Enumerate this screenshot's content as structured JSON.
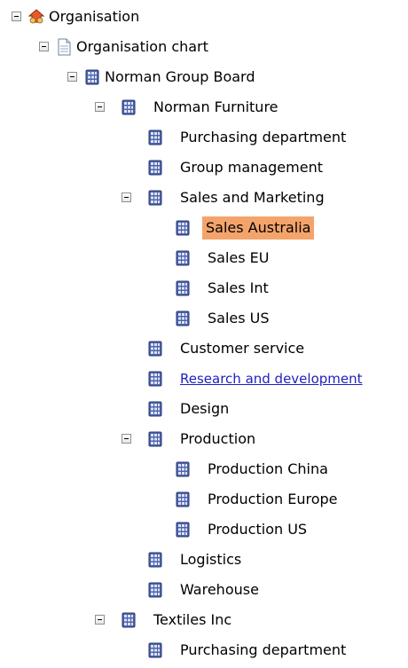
{
  "colors": {
    "selected_bg": "#f4a46a",
    "link": "#1f1fbf",
    "toggle_border": "#8e8f8f"
  },
  "tree": {
    "nodes": [
      {
        "label": "Organisation",
        "icon": "organisation-icon",
        "expanded": true
      },
      {
        "label": "Organisation chart",
        "icon": "document-icon",
        "expanded": true
      },
      {
        "label": "Norman Group Board",
        "icon": "building-icon",
        "expanded": true
      },
      {
        "label": "Norman Furniture",
        "icon": "building-icon",
        "expanded": true
      },
      {
        "label": "Purchasing department",
        "icon": "building-icon"
      },
      {
        "label": "Group management",
        "icon": "building-icon"
      },
      {
        "label": "Sales and Marketing",
        "icon": "building-icon",
        "expanded": true
      },
      {
        "label": "Sales Australia",
        "icon": "building-icon",
        "selected": true
      },
      {
        "label": "Sales EU",
        "icon": "building-icon"
      },
      {
        "label": "Sales Int",
        "icon": "building-icon"
      },
      {
        "label": "Sales US",
        "icon": "building-icon"
      },
      {
        "label": "Customer service",
        "icon": "building-icon"
      },
      {
        "label": "Research and development",
        "icon": "building-icon",
        "hovered": true
      },
      {
        "label": "Design",
        "icon": "building-icon"
      },
      {
        "label": "Production",
        "icon": "building-icon",
        "expanded": true
      },
      {
        "label": "Production China",
        "icon": "building-icon"
      },
      {
        "label": "Production Europe",
        "icon": "building-icon"
      },
      {
        "label": "Production US",
        "icon": "building-icon"
      },
      {
        "label": "Logistics",
        "icon": "building-icon"
      },
      {
        "label": "Warehouse",
        "icon": "building-icon"
      },
      {
        "label": "Textiles Inc",
        "icon": "building-icon",
        "expanded": true
      },
      {
        "label": "Purchasing department",
        "icon": "building-icon"
      }
    ]
  }
}
